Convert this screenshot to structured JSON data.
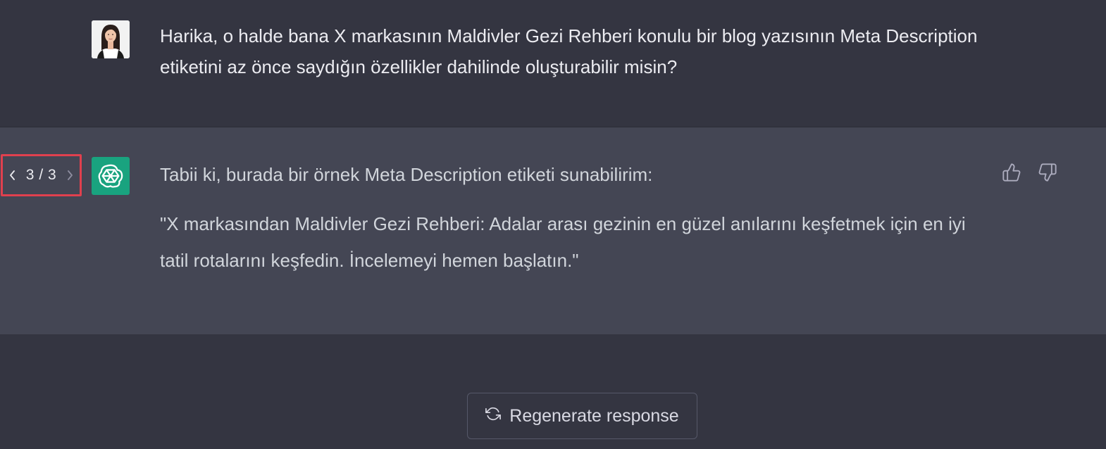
{
  "user_message": {
    "text": "Harika, o halde bana X markasının Maldivler Gezi Rehberi konulu bir blog yazısının Meta Description etiketini az önce saydığın özellikler dahilinde oluşturabilir misin?",
    "avatar_icon": "user-avatar-photo"
  },
  "assistant_message": {
    "pager": {
      "current": "3",
      "separator": "/",
      "total": "3",
      "prev_icon": "chevron-left-icon",
      "next_icon": "chevron-right-icon",
      "highlight_color": "#e0404e"
    },
    "avatar_icon": "openai-logo-icon",
    "avatar_color": "#19a37f",
    "paragraphs": [
      "Tabii ki, burada bir örnek Meta Description etiketi sunabilirim:",
      "\"X markasından Maldivler Gezi Rehberi: Adalar arası gezinin en güzel anılarını keşfetmek için en iyi tatil rotalarını keşfedin. İncelemeyi hemen başlatın.\""
    ],
    "feedback": {
      "like_icon": "thumbs-up-icon",
      "dislike_icon": "thumbs-down-icon"
    }
  },
  "regenerate": {
    "label": "Regenerate response",
    "icon": "refresh-icon"
  },
  "colors": {
    "background": "#343541",
    "assistant_background": "#444654"
  }
}
